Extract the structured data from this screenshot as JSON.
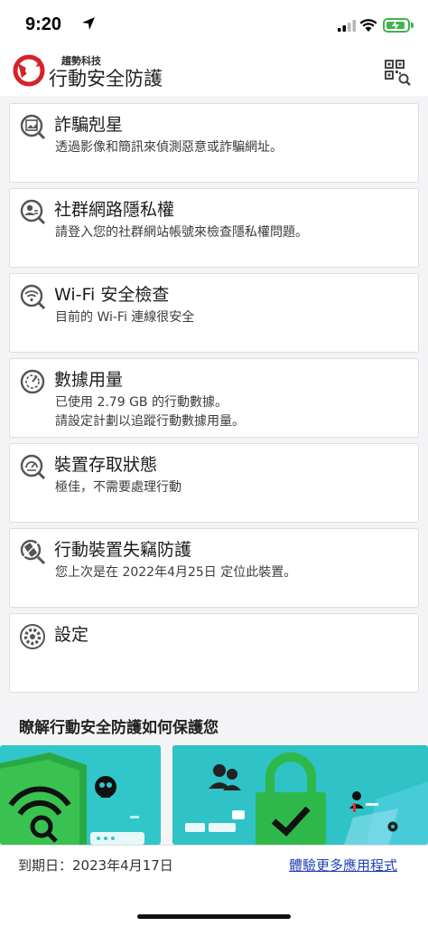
{
  "status_bar": {
    "time": "9:20"
  },
  "header": {
    "brand_sub": "趨勢科技",
    "brand_main": "行動安全防護",
    "qr_label": "QR"
  },
  "cards": [
    {
      "title": "詐騙剋星",
      "desc": "透過影像和簡訊來偵測惡意或詐騙網址。",
      "icon": "photo-scan-icon"
    },
    {
      "title": "社群網路隱私權",
      "desc": "請登入您的社群網站帳號來檢查隱私權問題。",
      "icon": "privacy-scan-icon"
    },
    {
      "title": "Wi-Fi 安全檢查",
      "desc": "目前的 Wi-Fi 連線很安全",
      "icon": "wifi-scan-icon"
    },
    {
      "title": "數據用量",
      "desc": "已使用 2.79 GB 的行動數據。",
      "desc2": "請設定計劃以追蹤行動數據用量。",
      "icon": "gauge-icon"
    },
    {
      "title": "裝置存取狀態",
      "desc": "極佳，不需要處理行動",
      "icon": "speedometer-icon"
    },
    {
      "title": "行動裝置失竊防護",
      "desc": "您上次是在 2022年4月25日 定位此裝置。",
      "icon": "lost-device-icon"
    },
    {
      "title": "設定",
      "desc": "",
      "icon": "gear-icon"
    }
  ],
  "learn": {
    "heading": "瞭解行動安全防護如何保護您"
  },
  "footer": {
    "expiry": "到期日：2023年4月17日",
    "more_apps": "體驗更多應用程式"
  },
  "colors": {
    "accent_red": "#d6232b",
    "link_blue": "#1f3fb8",
    "promo_teal": "#31c6c9",
    "promo_green": "#2fb84a"
  }
}
